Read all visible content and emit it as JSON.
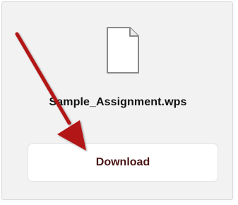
{
  "file": {
    "name": "Sample_Assignment.wps",
    "icon": "document-icon"
  },
  "actions": {
    "download_label": "Download"
  },
  "annotation": {
    "arrow_color": "#b31515"
  }
}
